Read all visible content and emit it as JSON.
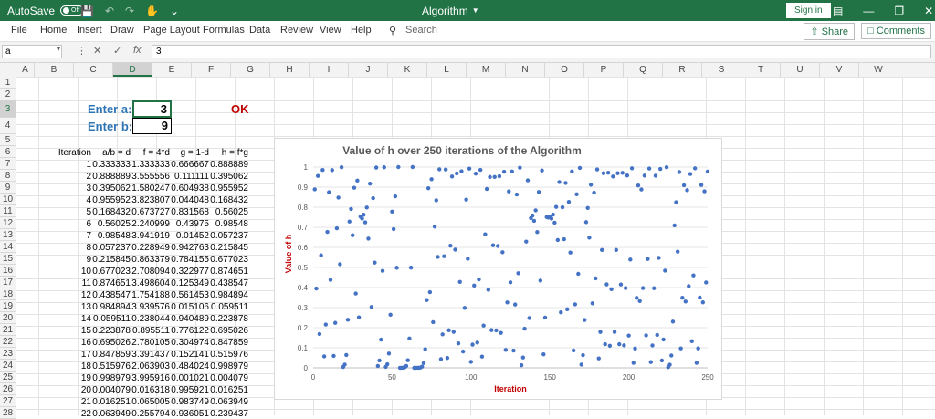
{
  "titlebar": {
    "autosave_label": "AutoSave",
    "autosave_state": "Off",
    "document_title": "Algorithm",
    "signin_label": "Sign in"
  },
  "menu": {
    "items": [
      "File",
      "Home",
      "Insert",
      "Draw",
      "Page Layout",
      "Formulas",
      "Data",
      "Review",
      "View",
      "Help"
    ],
    "search_label": "Search",
    "share_label": "Share",
    "comments_label": "Comments"
  },
  "formula_bar": {
    "name_box": "a",
    "fx_label": "fx",
    "value": "3"
  },
  "columns": [
    "A",
    "B",
    "C",
    "D",
    "E",
    "F",
    "G",
    "H",
    "I",
    "J",
    "K",
    "L",
    "M",
    "N",
    "O",
    "P",
    "Q",
    "R",
    "S",
    "T",
    "U",
    "V",
    "W"
  ],
  "rows": [
    "1",
    "2",
    "3",
    "4",
    "5",
    "6",
    "7",
    "8",
    "9",
    "10",
    "11",
    "12",
    "13",
    "14",
    "15",
    "16",
    "17",
    "18",
    "19",
    "20",
    "21",
    "22",
    "23",
    "24",
    "25",
    "26",
    "27",
    "28"
  ],
  "inputs": {
    "a_label": "Enter a:",
    "a_value": "3",
    "b_label": "Enter b:",
    "b_value": "9",
    "status": "OK"
  },
  "table": {
    "headers": [
      "Iteration",
      "a/b = d",
      "f = 4*d",
      "g = 1-d",
      "h = f*g"
    ],
    "rows": [
      [
        "1",
        "0.333333",
        "1.333333",
        "0.666667",
        "0.888889"
      ],
      [
        "2",
        "0.888889",
        "3.555556",
        "0.111111",
        "0.395062"
      ],
      [
        "3",
        "0.395062",
        "1.580247",
        "0.604938",
        "0.955952"
      ],
      [
        "4",
        "0.955952",
        "3.823807",
        "0.044048",
        "0.168432"
      ],
      [
        "5",
        "0.168432",
        "0.673727",
        "0.831568",
        "0.56025"
      ],
      [
        "6",
        "0.56025",
        "2.240999",
        "0.43975",
        "0.98548"
      ],
      [
        "7",
        "0.98548",
        "3.941919",
        "0.01452",
        "0.057237"
      ],
      [
        "8",
        "0.057237",
        "0.228949",
        "0.942763",
        "0.215845"
      ],
      [
        "9",
        "0.215845",
        "0.863379",
        "0.784155",
        "0.677023"
      ],
      [
        "10",
        "0.677023",
        "2.708094",
        "0.322977",
        "0.874651"
      ],
      [
        "11",
        "0.874651",
        "3.498604",
        "0.125349",
        "0.438547"
      ],
      [
        "12",
        "0.438547",
        "1.754188",
        "0.561453",
        "0.984894"
      ],
      [
        "13",
        "0.984894",
        "3.939576",
        "0.015106",
        "0.059511"
      ],
      [
        "14",
        "0.059511",
        "0.238044",
        "0.940489",
        "0.223878"
      ],
      [
        "15",
        "0.223878",
        "0.895511",
        "0.776122",
        "0.695026"
      ],
      [
        "16",
        "0.695026",
        "2.780105",
        "0.304974",
        "0.847859"
      ],
      [
        "17",
        "0.847859",
        "3.391437",
        "0.152141",
        "0.515976"
      ],
      [
        "18",
        "0.515976",
        "2.063903",
        "0.484024",
        "0.998979"
      ],
      [
        "19",
        "0.998979",
        "3.995916",
        "0.001021",
        "0.004079"
      ],
      [
        "20",
        "0.004079",
        "0.016318",
        "0.995921",
        "0.016251"
      ],
      [
        "21",
        "0.016251",
        "0.065005",
        "0.983749",
        "0.063949"
      ],
      [
        "22",
        "0.063949",
        "0.255794",
        "0.936051",
        "0.239437"
      ]
    ]
  },
  "chart_data": {
    "type": "scatter",
    "title": "Value of h over 250 iterations of the Algorithm",
    "xlabel": "Iteration",
    "ylabel": "Value of h",
    "xlim": [
      0,
      250
    ],
    "ylim": [
      0,
      1
    ],
    "xticks": [
      "0",
      "50",
      "100",
      "150",
      "200",
      "250"
    ],
    "yticks": [
      "0",
      "0.1",
      "0.2",
      "0.3",
      "0.4",
      "0.5",
      "0.6",
      "0.7",
      "0.8",
      "0.9",
      "1"
    ],
    "grid": "horizontal",
    "marker_color": "#4472c4",
    "series": [
      {
        "x0": 1,
        "x1": 250,
        "seed_a": 3,
        "seed_b": 9
      }
    ]
  },
  "colors": {
    "excel_green": "#217346",
    "label_blue": "#2e75b6",
    "ok_red": "#c00000",
    "axis_title_red": "#c00000"
  }
}
